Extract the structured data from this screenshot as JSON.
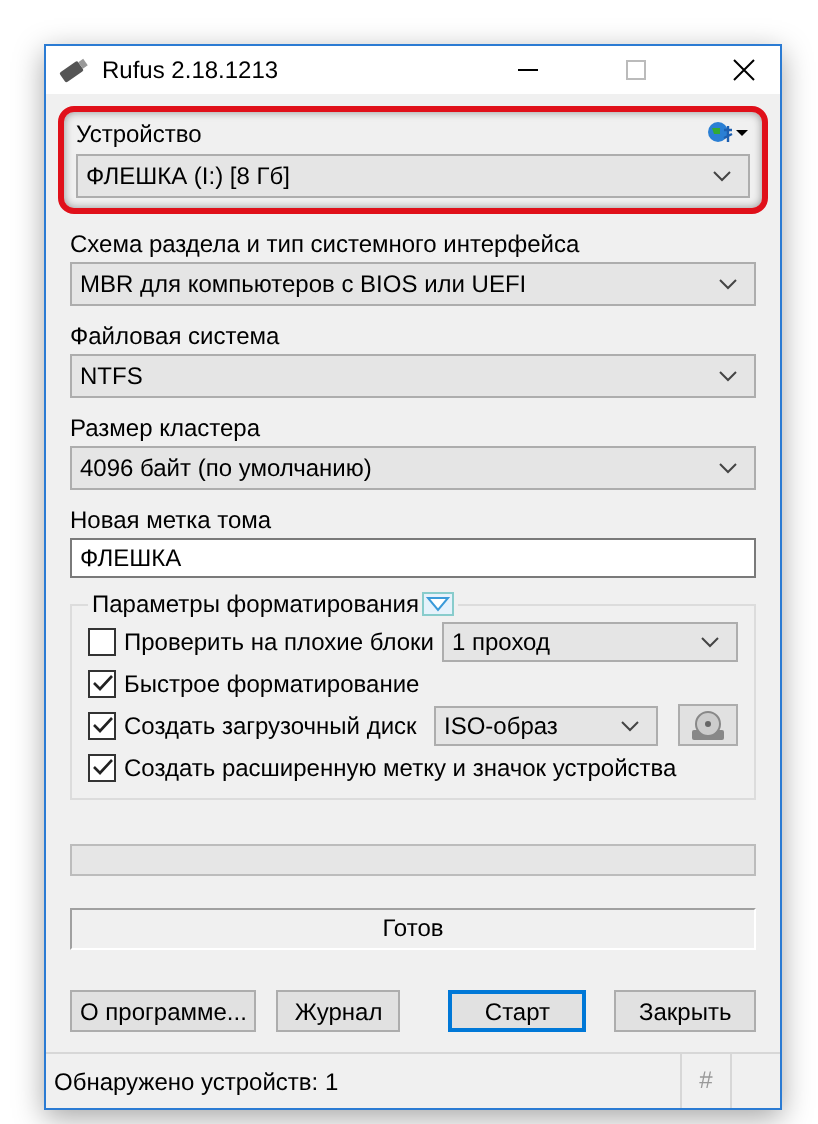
{
  "window": {
    "title": "Rufus 2.18.1213"
  },
  "device": {
    "label": "Устройство",
    "value": "ФЛЕШКА (I:) [8 Гб]",
    "highlighted": true
  },
  "fields": [
    {
      "label": "Схема раздела и тип системного интерфейса",
      "kind": "dropdown",
      "value": "MBR для компьютеров с BIOS или UEFI"
    },
    {
      "label": "Файловая система",
      "kind": "dropdown",
      "value": "NTFS"
    },
    {
      "label": "Размер кластера",
      "kind": "dropdown",
      "value": "4096 байт (по умолчанию)"
    },
    {
      "label": "Новая метка тома",
      "kind": "input",
      "value": "ФЛЕШКА"
    }
  ],
  "format_options": {
    "title": "Параметры форматирования",
    "options": [
      {
        "label": "Проверить на плохие блоки",
        "checked": false,
        "kind": "dropdown",
        "value": "1 проход"
      },
      {
        "label": "Быстрое форматирование",
        "checked": true,
        "kind": "plain"
      },
      {
        "label": "Создать загрузочный диск",
        "checked": true,
        "kind": "iso",
        "value": "ISO-образ"
      },
      {
        "label": "Создать расширенную метку и значок устройства",
        "checked": true,
        "kind": "plain"
      }
    ]
  },
  "progress": {
    "level": 0
  },
  "status": "Готов",
  "buttons": [
    {
      "label": "О программе...",
      "selected": false
    },
    {
      "label": "Журнал",
      "selected": false
    },
    {
      "label": "Старт",
      "selected": true
    },
    {
      "label": "Закрыть",
      "selected": false
    }
  ],
  "status_bar": {
    "text": "Обнаружено устройств: 1",
    "hash": "#"
  }
}
